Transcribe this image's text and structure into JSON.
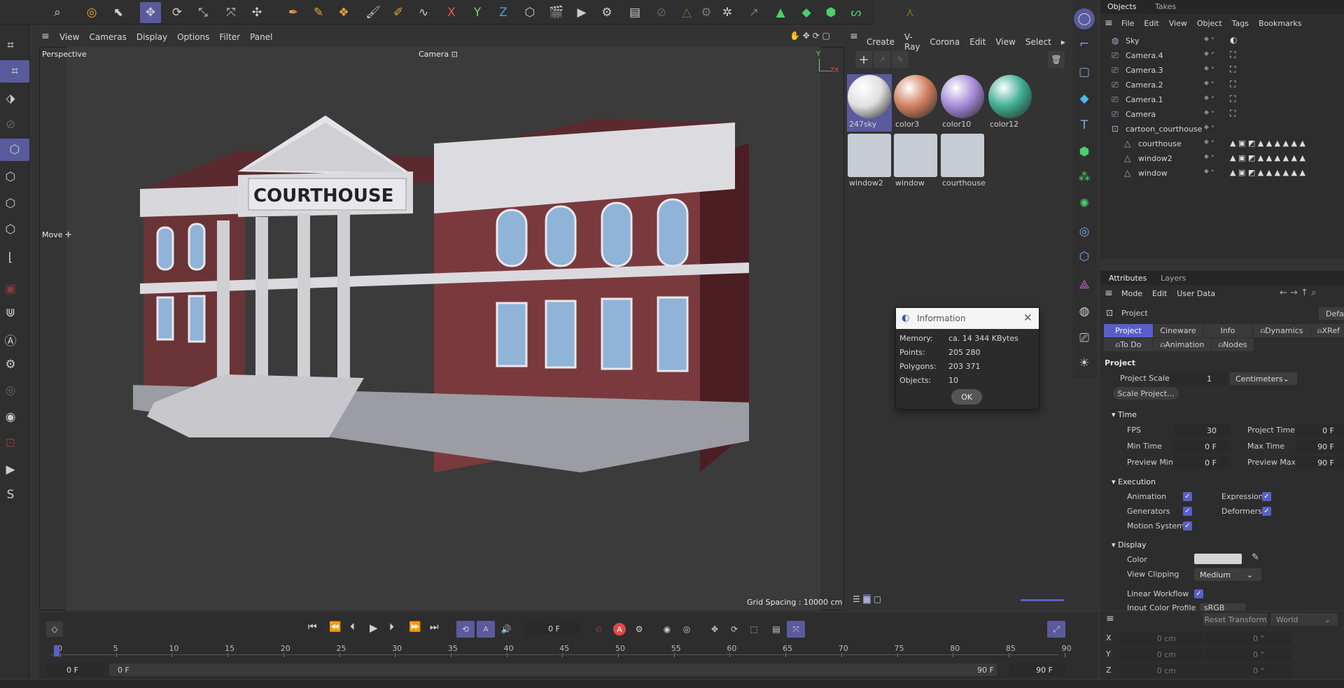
{
  "toolbar": {
    "icons": [
      "search-icon",
      "live-select-icon",
      "selection-tools-icon",
      "move-icon",
      "rotate-icon",
      "scale-icon",
      "axis-move-icon",
      "snap-icon",
      "spline-pen-icon",
      "sketch-icon",
      "spline-tools-icon",
      "brush-icon",
      "paint-icon",
      "twist-icon",
      "x-axis-icon",
      "y-axis-icon",
      "z-axis-icon",
      "coordinate-system-icon",
      "render-view-icon",
      "render-icon",
      "render-settings-icon",
      "picture-viewer-icon",
      "link-icon",
      "cone-icon",
      "gear-icon",
      "particles-icon",
      "arrow-icon",
      "triangle-icon",
      "cube-icon",
      "cube-alt-icon",
      "spline-icon",
      "figure-icon"
    ]
  },
  "viewport": {
    "menu": [
      "View",
      "Cameras",
      "Display",
      "Options",
      "Filter",
      "Panel"
    ],
    "label": "Perspective",
    "camera": "Camera",
    "tool_hint": "Move",
    "grid": "Grid Spacing : 10000 cm",
    "sign": "COURTHOUSE",
    "axis_y": "Y",
    "axis_z": "Z",
    "axis_x": "X"
  },
  "materials": {
    "menu": [
      "Create",
      "V-Ray",
      "Corona",
      "Edit",
      "View",
      "Select"
    ],
    "items": [
      {
        "name": "247sky",
        "color": "#e0e0e0",
        "selected": true
      },
      {
        "name": "color3",
        "color": "#d08060"
      },
      {
        "name": "color10",
        "color": "#a58ad8"
      },
      {
        "name": "color12",
        "color": "#3fae92"
      },
      {
        "name": "window2",
        "color": "#9aa8b8"
      },
      {
        "name": "window",
        "color": "#9aa8b8"
      },
      {
        "name": "courthouse",
        "color": "#8a7a78"
      }
    ]
  },
  "dialog": {
    "title": "Information",
    "rows": [
      {
        "label": "Memory:",
        "value": "ca. 14 344 KBytes"
      },
      {
        "label": "Points:",
        "value": "205 280"
      },
      {
        "label": "Polygons:",
        "value": "203 371"
      },
      {
        "label": "Objects:",
        "value": "10"
      }
    ],
    "ok": "OK"
  },
  "objects": {
    "tabs": [
      "Objects",
      "Takes"
    ],
    "menu": [
      "File",
      "Edit",
      "View",
      "Object",
      "Tags",
      "Bookmarks"
    ],
    "rows": [
      {
        "name": "Sky",
        "indent": 0
      },
      {
        "name": "Camera.4",
        "indent": 0
      },
      {
        "name": "Camera.3",
        "indent": 0
      },
      {
        "name": "Camera.2",
        "indent": 0
      },
      {
        "name": "Camera.1",
        "indent": 0
      },
      {
        "name": "Camera",
        "indent": 0
      },
      {
        "name": "cartoon_courthouse",
        "indent": 0
      },
      {
        "name": "courthouse",
        "indent": 1
      },
      {
        "name": "window2",
        "indent": 1
      },
      {
        "name": "window",
        "indent": 1
      }
    ]
  },
  "attributes": {
    "tabs": [
      "Attributes",
      "Layers"
    ],
    "menu": [
      "Mode",
      "Edit",
      "User Data"
    ],
    "object": "Project",
    "preset": "Defau",
    "ptabs": [
      "Project",
      "Cineware",
      "Info",
      "Dynamics",
      "XRef"
    ],
    "ptabs2": [
      "To Do",
      "Animation",
      "Nodes"
    ],
    "section": "Project",
    "scale_label": "Project Scale",
    "scale_value": "1",
    "scale_unit": "Centimeters",
    "scale_btn": "Scale Project...",
    "time": "Time",
    "fps_label": "FPS",
    "fps": "30",
    "ptime_label": "Project Time",
    "ptime": "0 F",
    "mint_label": "Min Time",
    "mint": "0 F",
    "maxt_label": "Max Time",
    "maxt": "90 F",
    "pmin_label": "Preview Min",
    "pmin": "0 F",
    "pmax_label": "Preview Max",
    "pmax": "90 F",
    "execution": "Execution",
    "animation": "Animation",
    "expression": "Expression",
    "generators": "Generators",
    "deformers": "Deformers",
    "motion": "Motion System",
    "display": "Display",
    "color_label": "Color",
    "clip_label": "View Clipping",
    "clip_value": "Medium",
    "linear_label": "Linear Workflow",
    "profile_label": "Input Color Profile",
    "profile_value": "sRGB"
  },
  "coords": {
    "reset": "Reset Transform",
    "space": "World",
    "x": "X",
    "y": "Y",
    "z": "Z",
    "pos": "0 cm",
    "rot": "0 °"
  },
  "timeline": {
    "current": "0 F",
    "ticks": [
      "0",
      "5",
      "10",
      "15",
      "20",
      "25",
      "30",
      "35",
      "40",
      "45",
      "50",
      "55",
      "60",
      "65",
      "70",
      "75",
      "80",
      "85",
      "90"
    ],
    "start": "0 F",
    "range_start": "0 F",
    "range_end": "90 F",
    "end": "90 F"
  },
  "left_tools": [
    "make-editable-icon",
    "grid-icon",
    "workplane-icon",
    "texture-icon",
    "brush-icon",
    "model-icon",
    "points-icon",
    "edges-icon",
    "polygons-icon",
    "axis-icon",
    "layer-icon",
    "magnet-icon",
    "text-icon",
    "settings-icon",
    "sound-icon",
    "rig-icon",
    "eye-icon",
    "keyframe-icon",
    "render-region-icon",
    "s-icon"
  ],
  "right_tools": [
    "sphere-icon",
    "pen-icon",
    "square-icon",
    "cube-icon",
    "text-icon",
    "generator-icon",
    "cloner-icon",
    "effector-icon",
    "deformer-icon",
    "field-icon",
    "spline-icon",
    "environment-icon",
    "camera-icon",
    "light-icon"
  ]
}
